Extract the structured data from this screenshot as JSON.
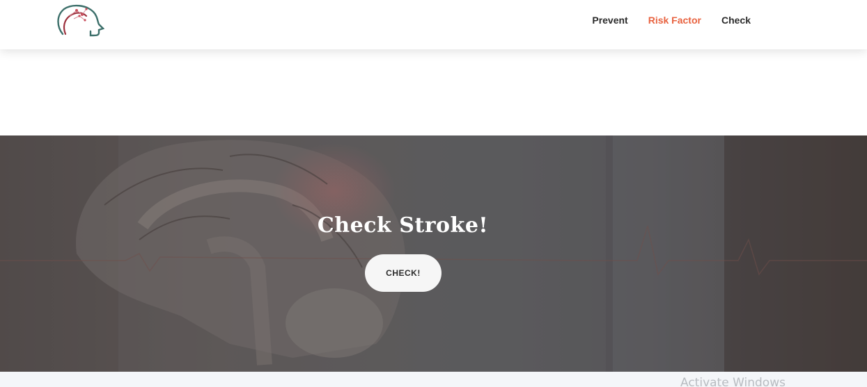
{
  "nav": {
    "items": [
      {
        "label": "Prevent",
        "active": false
      },
      {
        "label": "Risk Factor",
        "active": true
      },
      {
        "label": "Check",
        "active": false
      }
    ],
    "active_color": "#e8623f"
  },
  "previous_section": {
    "text_fragment": "Stroke!"
  },
  "hero": {
    "title": "Check Stroke!",
    "button_label": "CHECK!"
  },
  "watermark": {
    "text": "Activate Windows"
  },
  "icons": {
    "logo": "head-brain-logo-icon"
  }
}
